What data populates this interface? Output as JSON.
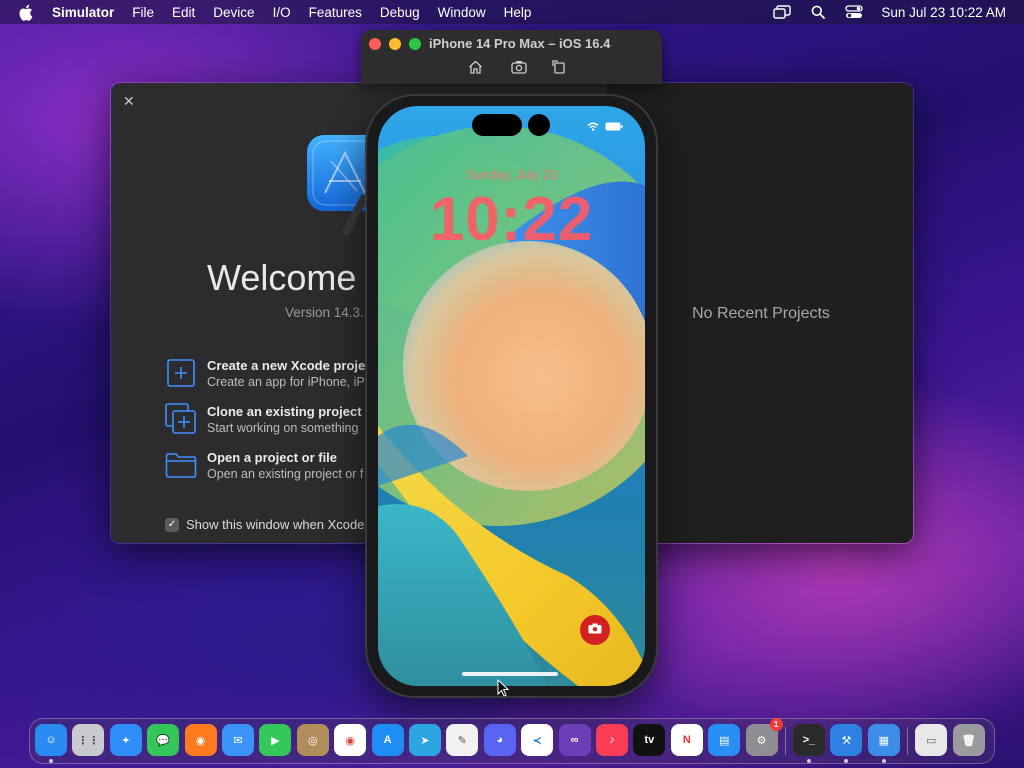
{
  "menubar": {
    "app_name": "Simulator",
    "items": [
      "File",
      "Edit",
      "Device",
      "I/O",
      "Features",
      "Debug",
      "Window",
      "Help"
    ],
    "clock": "Sun Jul 23  10:22 AM"
  },
  "xcode_welcome": {
    "title": "Welcome",
    "version": "Version 14.3.1",
    "actions": [
      {
        "title": "Create a new Xcode proje",
        "subtitle": "Create an app for iPhone, iPa"
      },
      {
        "title": "Clone an existing project",
        "subtitle": "Start working on something"
      },
      {
        "title": "Open a project or file",
        "subtitle": "Open an existing project or f"
      }
    ],
    "show_on_launch_label": "Show this window when Xcode",
    "show_on_launch_checked": true,
    "no_recent": "No Recent Projects"
  },
  "simulator": {
    "title": "iPhone 14 Pro Max – iOS 16.4",
    "toolbar": [
      "home-icon",
      "screenshot-icon",
      "rotate-icon"
    ]
  },
  "lockscreen": {
    "date": "Sunday, July 23",
    "time": "10:22"
  },
  "dock": {
    "apps": [
      {
        "name": "Finder",
        "icon": "finder-icon",
        "color": "#2a8cf0",
        "running": true
      },
      {
        "name": "Launchpad",
        "icon": "launchpad-icon",
        "color": "#c9c9cf",
        "running": false
      },
      {
        "name": "Safari",
        "icon": "safari-icon",
        "color": "#2f8df7",
        "running": false
      },
      {
        "name": "Messages",
        "icon": "messages-icon",
        "color": "#33c759",
        "running": false
      },
      {
        "name": "Firefox",
        "icon": "firefox-icon",
        "color": "#ff7a1c",
        "running": false
      },
      {
        "name": "Mail",
        "icon": "mail-icon",
        "color": "#3a93f5",
        "running": false
      },
      {
        "name": "FaceTime",
        "icon": "facetime-icon",
        "color": "#34c75a",
        "running": false
      },
      {
        "name": "Contacts",
        "icon": "contacts-icon",
        "color": "#b08d5a",
        "running": false
      },
      {
        "name": "Chrome",
        "icon": "chrome-icon",
        "color": "#ffffff",
        "running": false
      },
      {
        "name": "App Store",
        "icon": "app-store-icon",
        "color": "#1e8ef5",
        "running": false
      },
      {
        "name": "Telegram",
        "icon": "telegram-icon",
        "color": "#2ca5e0",
        "running": false
      },
      {
        "name": "TextEdit",
        "icon": "textedit-icon",
        "color": "#f1f1f1",
        "running": false
      },
      {
        "name": "Discord",
        "icon": "discord-icon",
        "color": "#5865f2",
        "running": false
      },
      {
        "name": "VS Code",
        "icon": "vscode-icon",
        "color": "#ffffff",
        "running": false
      },
      {
        "name": "Visual Studio",
        "icon": "visual-studio-icon",
        "color": "#6c3fb8",
        "running": false
      },
      {
        "name": "Music",
        "icon": "music-icon",
        "color": "#fa3c55",
        "running": false
      },
      {
        "name": "TV",
        "icon": "tv-icon",
        "color": "#111111",
        "running": false,
        "label": "tv"
      },
      {
        "name": "News",
        "icon": "news-icon",
        "color": "#ffffff",
        "running": false
      },
      {
        "name": "Keynote",
        "icon": "keynote-icon",
        "color": "#2a8ff5",
        "running": false
      },
      {
        "name": "System Settings",
        "icon": "settings-icon",
        "color": "#8e8e93",
        "running": false,
        "badge": "1"
      }
    ],
    "recent_apps": [
      {
        "name": "Terminal",
        "icon": "terminal-icon",
        "color": "#2a2a2a",
        "running": true
      },
      {
        "name": "Xcode",
        "icon": "xcode-icon",
        "color": "#2d7fe0",
        "running": true
      },
      {
        "name": "Simulator",
        "icon": "simulator-icon",
        "color": "#3b8de8",
        "running": true
      }
    ],
    "others": [
      {
        "name": "Downloads",
        "icon": "downloads-stack-icon",
        "color": "#e8e8e8"
      },
      {
        "name": "Trash",
        "icon": "trash-icon",
        "color": "#9a9a9f"
      }
    ]
  }
}
